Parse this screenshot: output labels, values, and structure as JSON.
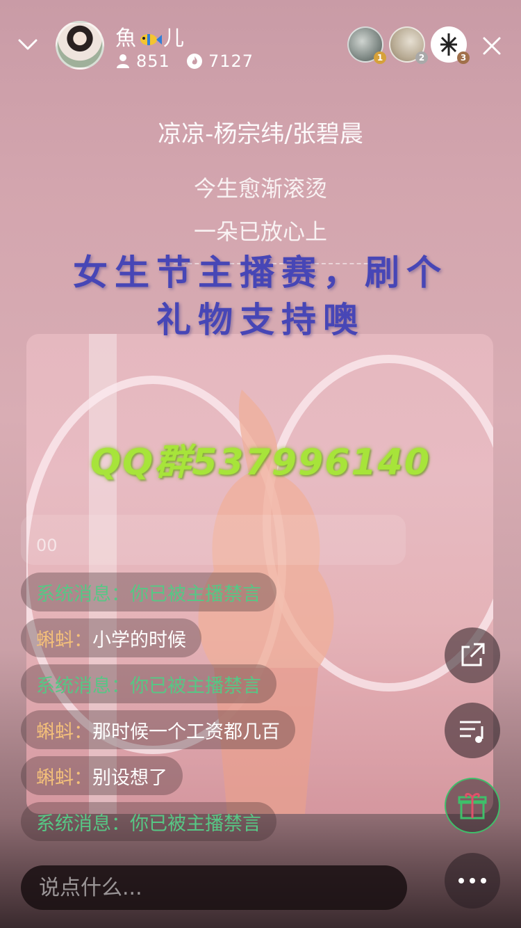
{
  "header": {
    "host_name_part1": "魚",
    "host_name_part2": "儿",
    "followers": "851",
    "heat": "7127",
    "top_ranks": [
      "1",
      "2",
      "3"
    ]
  },
  "lyrics": {
    "song_title": "凉凉-杨宗纬/张碧晨",
    "line1": "今生愈渐滚烫",
    "line2": "一朵已放心上"
  },
  "banner": {
    "line1": "女生节主播赛，刷个",
    "line2": "礼物支持噢"
  },
  "overlay": {
    "qq_group": "QQ群537996140",
    "pinned_text": "00"
  },
  "chat": [
    {
      "type": "system",
      "name": "系统消息：",
      "text": "你已被主播禁言"
    },
    {
      "type": "user",
      "name": "蝌蚪：",
      "text": "小学的时候"
    },
    {
      "type": "system",
      "name": "系统消息：",
      "text": "你已被主播禁言"
    },
    {
      "type": "user",
      "name": "蝌蚪：",
      "text": "那时候一个工资都几百"
    },
    {
      "type": "user",
      "name": "蝌蚪：",
      "text": "别设想了"
    },
    {
      "type": "system",
      "name": "系统消息：",
      "text": "你已被主播禁言"
    }
  ],
  "input": {
    "placeholder": "说点什么..."
  },
  "icons": {
    "back": "chevron-down-icon",
    "close": "close-icon",
    "share": "share-icon",
    "music": "playlist-music-icon",
    "gift": "gift-icon",
    "more": "more-dots-icon"
  },
  "colors": {
    "system_message": "#57c785",
    "username": "#f4c07a",
    "gift_accent": "#3fbf6a",
    "banner": "#4746b6",
    "qq_text": "#a7e43a"
  }
}
